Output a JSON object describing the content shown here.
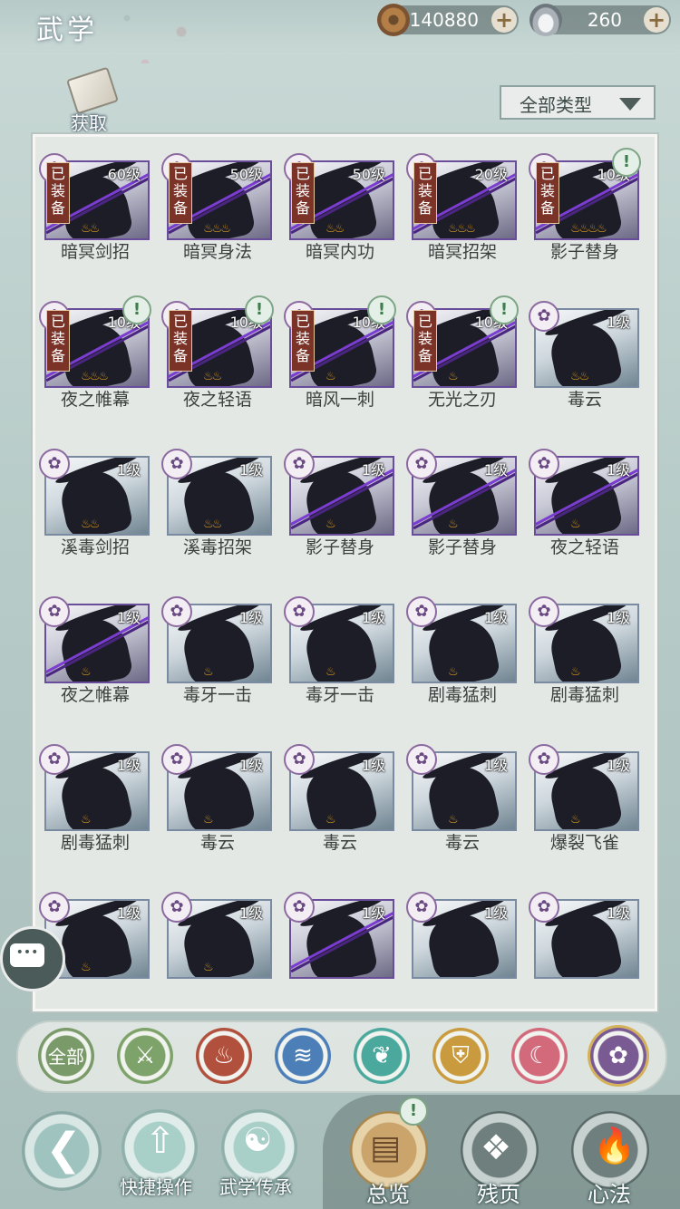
{
  "header": {
    "title": "武学"
  },
  "currency": {
    "coins": "140880",
    "silver": "260",
    "plus": "+"
  },
  "get_button": {
    "label": "获取"
  },
  "filter": {
    "label": "全部类型"
  },
  "skills": [
    {
      "name": "暗冥剑招",
      "level": "60级",
      "equipped": true,
      "stars": "♨♨",
      "alert": false,
      "tone": "purple"
    },
    {
      "name": "暗冥身法",
      "level": "50级",
      "equipped": true,
      "stars": "♨♨♨",
      "alert": false,
      "tone": "purple"
    },
    {
      "name": "暗冥内功",
      "level": "50级",
      "equipped": true,
      "stars": "♨♨",
      "alert": false,
      "tone": "purple"
    },
    {
      "name": "暗冥招架",
      "level": "20级",
      "equipped": true,
      "stars": "♨♨♨",
      "alert": false,
      "tone": "purple"
    },
    {
      "name": "影子替身",
      "level": "10级",
      "equipped": true,
      "stars": "♨♨♨♨",
      "alert": true,
      "tone": "purple"
    },
    {
      "name": "夜之帷幕",
      "level": "10级",
      "equipped": true,
      "stars": "♨♨♨",
      "alert": true,
      "tone": "purple"
    },
    {
      "name": "夜之轻语",
      "level": "10级",
      "equipped": true,
      "stars": "♨♨",
      "alert": true,
      "tone": "purple"
    },
    {
      "name": "暗风一刺",
      "level": "10级",
      "equipped": true,
      "stars": "♨",
      "alert": true,
      "tone": "purple"
    },
    {
      "name": "无光之刃",
      "level": "10级",
      "equipped": true,
      "stars": "♨",
      "alert": true,
      "tone": "purple"
    },
    {
      "name": "毒云",
      "level": "1级",
      "equipped": false,
      "stars": "♨♨",
      "alert": false,
      "tone": "white"
    },
    {
      "name": "溪毒剑招",
      "level": "1级",
      "equipped": false,
      "stars": "♨♨",
      "alert": false,
      "tone": "white"
    },
    {
      "name": "溪毒招架",
      "level": "1级",
      "equipped": false,
      "stars": "♨♨",
      "alert": false,
      "tone": "white"
    },
    {
      "name": "影子替身",
      "level": "1级",
      "equipped": false,
      "stars": "♨",
      "alert": false,
      "tone": "purple"
    },
    {
      "name": "影子替身",
      "level": "1级",
      "equipped": false,
      "stars": "♨",
      "alert": false,
      "tone": "purple"
    },
    {
      "name": "夜之轻语",
      "level": "1级",
      "equipped": false,
      "stars": "♨",
      "alert": false,
      "tone": "purple"
    },
    {
      "name": "夜之帷幕",
      "level": "1级",
      "equipped": false,
      "stars": "♨",
      "alert": false,
      "tone": "purple"
    },
    {
      "name": "毒牙一击",
      "level": "1级",
      "equipped": false,
      "stars": "♨",
      "alert": false,
      "tone": "white"
    },
    {
      "name": "毒牙一击",
      "level": "1级",
      "equipped": false,
      "stars": "♨",
      "alert": false,
      "tone": "white"
    },
    {
      "name": "剧毒猛刺",
      "level": "1级",
      "equipped": false,
      "stars": "♨",
      "alert": false,
      "tone": "white"
    },
    {
      "name": "剧毒猛刺",
      "level": "1级",
      "equipped": false,
      "stars": "♨",
      "alert": false,
      "tone": "white"
    },
    {
      "name": "剧毒猛刺",
      "level": "1级",
      "equipped": false,
      "stars": "♨",
      "alert": false,
      "tone": "white"
    },
    {
      "name": "毒云",
      "level": "1级",
      "equipped": false,
      "stars": "♨",
      "alert": false,
      "tone": "white"
    },
    {
      "name": "毒云",
      "level": "1级",
      "equipped": false,
      "stars": "♨",
      "alert": false,
      "tone": "white"
    },
    {
      "name": "毒云",
      "level": "1级",
      "equipped": false,
      "stars": "♨",
      "alert": false,
      "tone": "white"
    },
    {
      "name": "爆裂飞雀",
      "level": "1级",
      "equipped": false,
      "stars": "♨",
      "alert": false,
      "tone": "white"
    },
    {
      "name": "",
      "level": "1级",
      "equipped": false,
      "stars": "♨",
      "alert": false,
      "tone": "white"
    },
    {
      "name": "",
      "level": "1级",
      "equipped": false,
      "stars": "♨",
      "alert": false,
      "tone": "white"
    },
    {
      "name": "",
      "level": "1级",
      "equipped": false,
      "stars": "",
      "alert": false,
      "tone": "purple"
    },
    {
      "name": "",
      "level": "1级",
      "equipped": false,
      "stars": "",
      "alert": false,
      "tone": "white"
    },
    {
      "name": "",
      "level": "1级",
      "equipped": false,
      "stars": "",
      "alert": false,
      "tone": "white"
    }
  ],
  "equipped_label": "已装备",
  "categories": [
    {
      "icon": "all-icon",
      "label": "全部",
      "color": "#7a9a6a"
    },
    {
      "icon": "sword-icon",
      "label": "⚔",
      "color": "#7ea36a"
    },
    {
      "icon": "fire-icon",
      "label": "♨",
      "color": "#b0503d"
    },
    {
      "icon": "wave-icon",
      "label": "≋",
      "color": "#4c7fb8"
    },
    {
      "icon": "butterfly-icon",
      "label": "❦",
      "color": "#4aa89d"
    },
    {
      "icon": "shield-icon",
      "label": "⛨",
      "color": "#c99b3e"
    },
    {
      "icon": "moon-icon",
      "label": "☾",
      "color": "#d36a7c"
    },
    {
      "icon": "rose-icon",
      "label": "✿",
      "color": "#7a5a92"
    }
  ],
  "bottom": {
    "quick_ops": "快捷操作",
    "inherit": "武学传承",
    "overview": "总览",
    "fragments": "残页",
    "mind": "心法"
  }
}
